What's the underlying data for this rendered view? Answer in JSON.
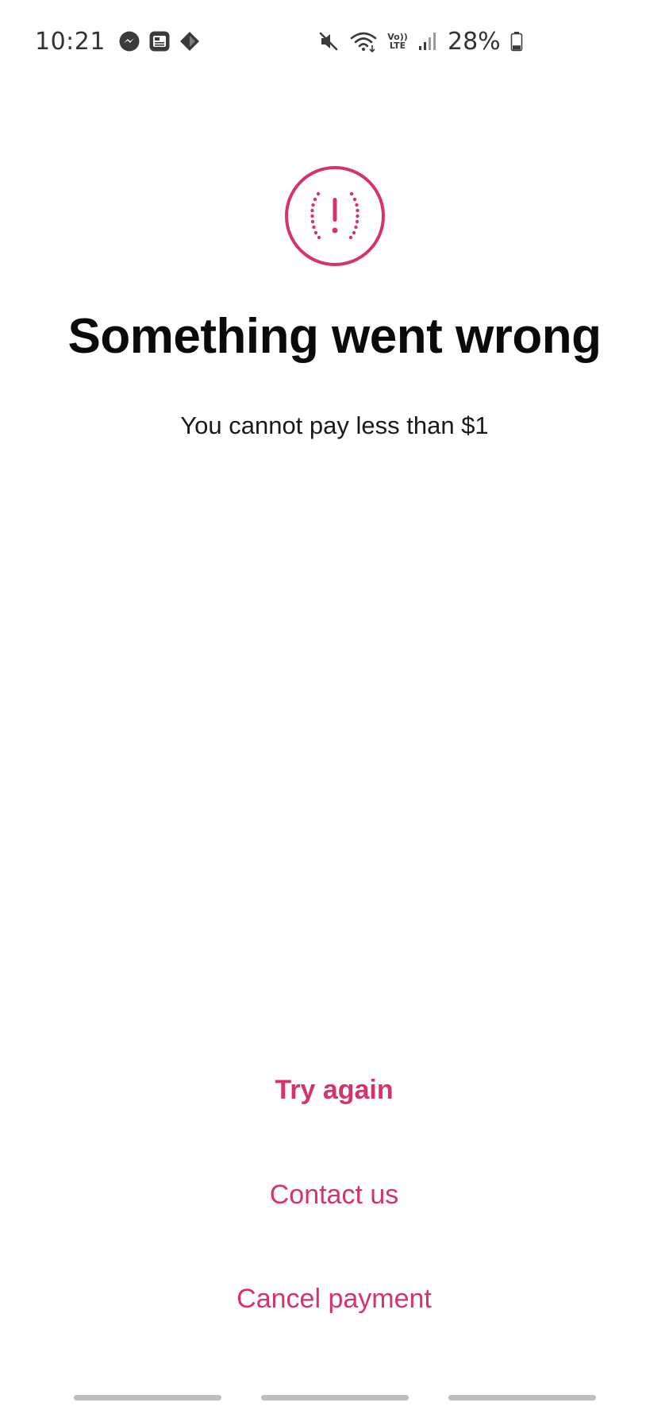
{
  "status_bar": {
    "time": "10:21",
    "battery_percent": "28%",
    "network_label_top": "Vo))",
    "network_label_bottom": "LTE",
    "left_icons": [
      "messenger-icon",
      "news-icon",
      "diamond-icon"
    ],
    "right_icons": [
      "mute-icon",
      "wifi-icon",
      "volte-icon",
      "signal-icon",
      "battery-icon"
    ],
    "battery_level": 0.28
  },
  "error": {
    "icon": "alert-circle-icon",
    "accent_color": "#d6336c",
    "title": "Something went wrong",
    "message": "You cannot pay less than $1"
  },
  "actions": {
    "try_again": "Try again",
    "contact_us": "Contact us",
    "cancel_payment": "Cancel payment"
  },
  "colors": {
    "accent": "#d6336c",
    "text": "#0a0a0a",
    "nav_handle": "#bdbdbd"
  }
}
